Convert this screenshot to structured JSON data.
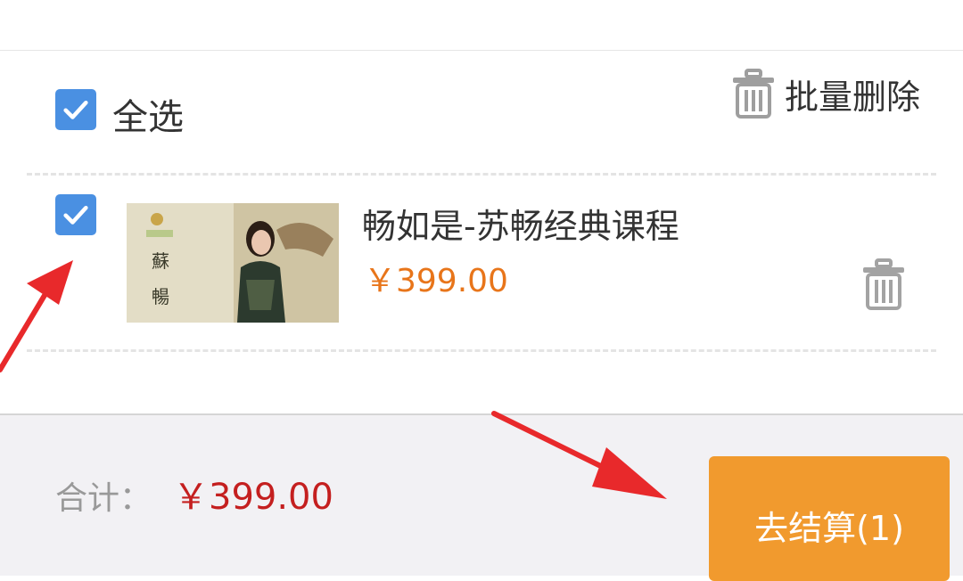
{
  "cart": {
    "select_all_label": "全选",
    "bulk_delete_label": "批量删除",
    "items": [
      {
        "title": "畅如是-苏畅经典课程",
        "price": "￥399.00",
        "checked": true
      }
    ]
  },
  "footer": {
    "total_label": "合计：",
    "total_value": "￥399.00",
    "checkout_label": "去结算(1)"
  },
  "colors": {
    "checkbox": "#4a90e2",
    "price": "#e8751a",
    "total": "#c41f1f",
    "checkout_button": "#f19a2e",
    "annotation_arrow": "#e8292b"
  },
  "icons": {
    "checkbox": "checkmark-icon",
    "delete": "trash-icon"
  }
}
